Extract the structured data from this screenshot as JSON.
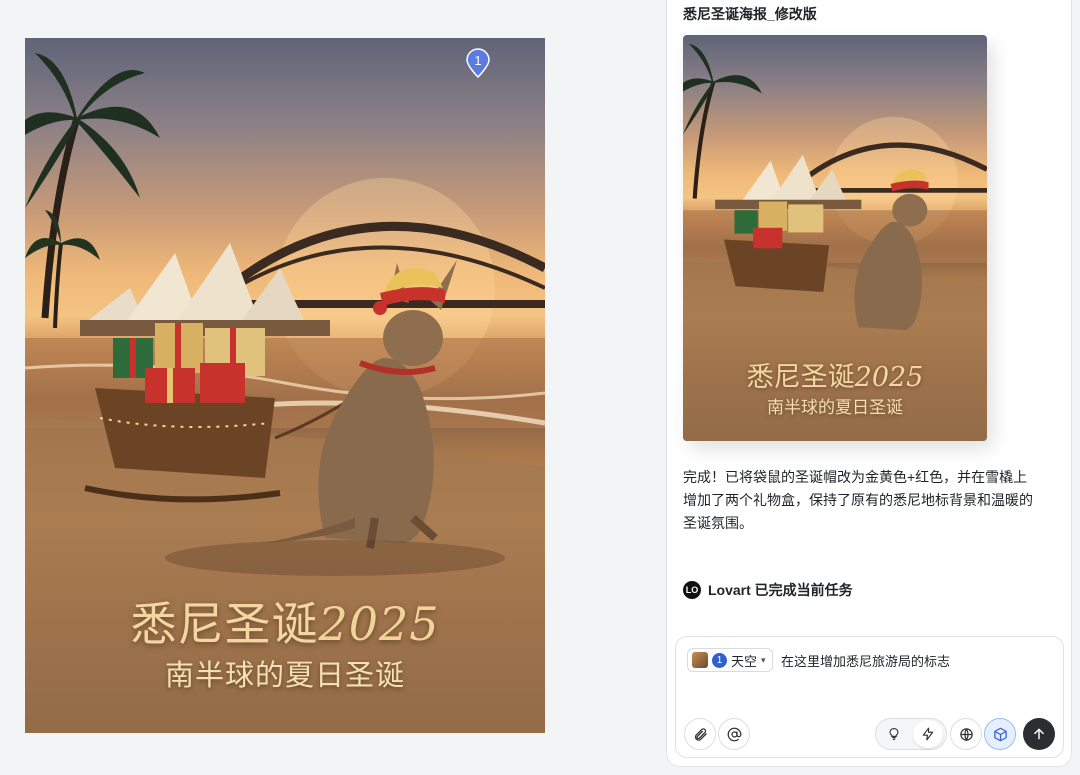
{
  "poster": {
    "title": "悉尼圣诞",
    "year": "2025",
    "subtitle": "南半球的夏日圣诞",
    "marker_number": "1"
  },
  "chat": {
    "message_title": "悉尼圣诞海报_修改版",
    "thumbnail": {
      "title": "悉尼圣诞",
      "year": "2025",
      "subtitle": "南半球的夏日圣诞"
    },
    "reply_text": "完成！已将袋鼠的圣诞帽改为金黄色+红色，并在雪橇上增加了两个礼物盒，保持了原有的悉尼地标背景和温暖的圣诞氛围。",
    "status_text": "Lovart 已完成当前任务",
    "status_logo": "LO"
  },
  "composer": {
    "chip_number": "1",
    "chip_label": "天空",
    "input_text": "在这里增加悉尼旅游局的标志"
  },
  "colors": {
    "accent_blue": "#2f5fd0",
    "send_button": "#2b2d31",
    "poster_gold": "#f3d7a2"
  },
  "icons": [
    "paperclip-icon",
    "at-icon",
    "bulb-icon",
    "lightning-icon",
    "globe-icon",
    "cube-icon",
    "arrow-up-icon"
  ]
}
